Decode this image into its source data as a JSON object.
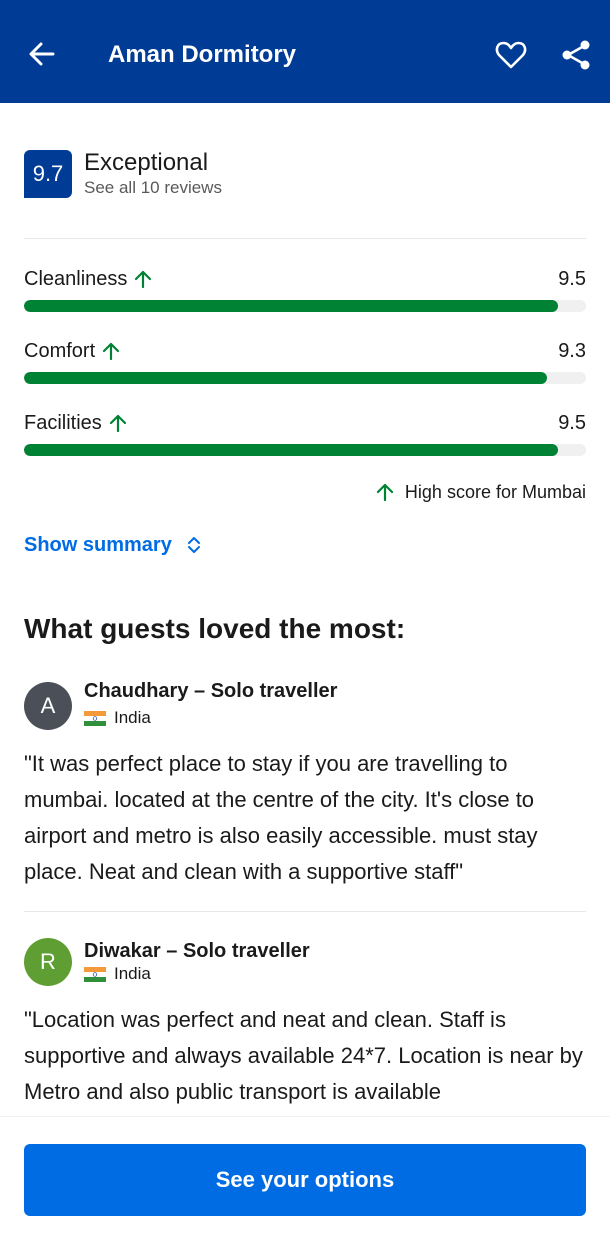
{
  "header": {
    "title": "Aman Dormitory",
    "back_icon": "arrow-left-icon",
    "favorite_icon": "heart-icon",
    "share_icon": "share-icon",
    "background_color": "#003b95"
  },
  "rating": {
    "score": "9.7",
    "label": "Exceptional",
    "reviews_link": "See all 10 reviews"
  },
  "categories": [
    {
      "label": "Cleanliness",
      "value": "9.5",
      "fraction": 0.95,
      "trend": "up"
    },
    {
      "label": "Comfort",
      "value": "9.3",
      "fraction": 0.93,
      "trend": "up"
    },
    {
      "label": "Facilities",
      "value": "9.5",
      "fraction": 0.95,
      "trend": "up"
    }
  ],
  "high_score_note": "High score for Mumbai",
  "show_summary": "Show summary",
  "loved_title": "What guests loved the most:",
  "reviews": [
    {
      "initial": "A",
      "avatar_color": "#4a4f58",
      "name": "Chaudhary – Solo traveller",
      "country": "India",
      "text": "\"It was perfect place to stay if you are travelling to mumbai. located at the centre of the city. It's close to airport and metro is also easily accessible. must stay place. Neat and clean with a supportive staff\""
    },
    {
      "initial": "R",
      "avatar_color": "#5f9e32",
      "name": "Diwakar – Solo traveller",
      "country": "India",
      "text": "\"Location was perfect and neat and clean. Staff is supportive and always available 24*7. Location is near by Metro and also public transport is available"
    }
  ],
  "cta": {
    "label": "See your options",
    "color": "#006ce4"
  },
  "accent_green": "#008234"
}
